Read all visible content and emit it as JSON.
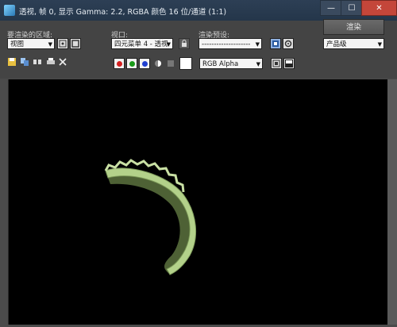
{
  "window": {
    "title": "透视, 帧 0, 显示 Gamma: 2.2, RGBA 颜色 16 位/通道 (1:1)",
    "minimize_label": "—",
    "maximize_label": "☐",
    "close_label": "✕"
  },
  "controls": {
    "area_label": "要渲染的区域:",
    "area_value": "视图",
    "viewport_label": "视口:",
    "viewport_value": "四元菜单 4 - 透视",
    "preset_label": "渲染预设:",
    "preset_value": "--------------------",
    "render_button": "渲染",
    "quality_value": "产品级",
    "channel_value": "RGB Alpha"
  },
  "colors": {
    "accent_red": "#d42020",
    "accent_green": "#1a9a1a",
    "accent_blue": "#1f3fd0",
    "object_green": "#b3d18a",
    "viewport_bg": "#000000"
  },
  "icons": [
    "save-icon",
    "copy-icon",
    "clone-icon",
    "print-icon",
    "clear-icon",
    "mono-icon",
    "lock-icon",
    "preset-icon",
    "settings-icon",
    "display-icon",
    "toggle-icon"
  ]
}
